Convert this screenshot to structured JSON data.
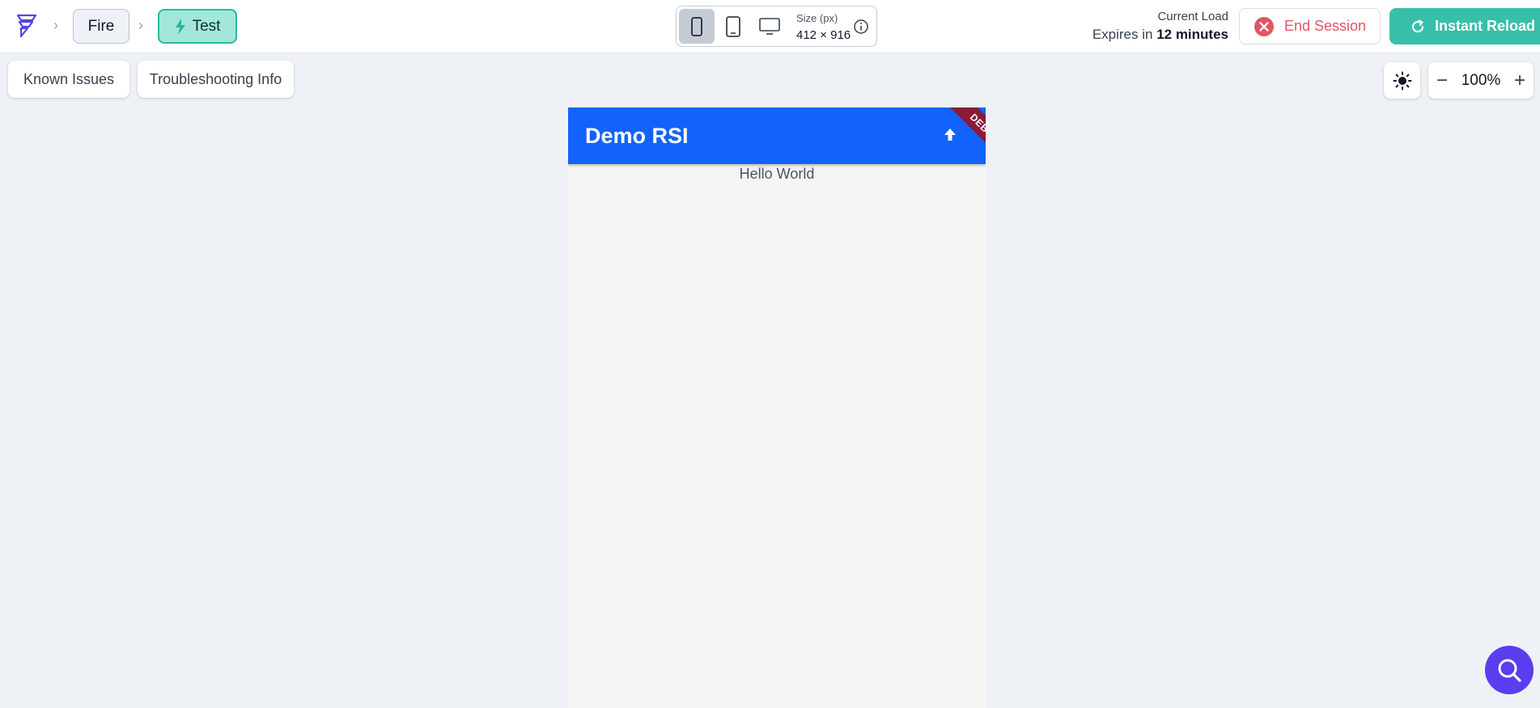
{
  "breadcrumb": {
    "fire_label": "Fire",
    "test_label": "Test"
  },
  "device_selector": {
    "size_label": "Size (px)",
    "size_value": "412 × 916"
  },
  "session": {
    "load_label": "Current Load",
    "expires_prefix": "Expires in",
    "expires_value": "12 minutes",
    "end_label": "End Session",
    "reload_label": "Instant Reload"
  },
  "toolbar": {
    "known_issues_label": "Known Issues",
    "troubleshooting_label": "Troubleshooting Info",
    "zoom_value": "100%",
    "zoom_minus": "−",
    "zoom_plus": "+"
  },
  "preview": {
    "app_title": "Demo RSI",
    "debug_label": "DEBUG",
    "body_text": "Hello World"
  },
  "colors": {
    "appbar": "#1263fb",
    "accent_teal": "#38bfa9",
    "end_session_red": "#e05565",
    "fab_purple": "#5b3df0",
    "debug_banner": "#8a1a35"
  }
}
